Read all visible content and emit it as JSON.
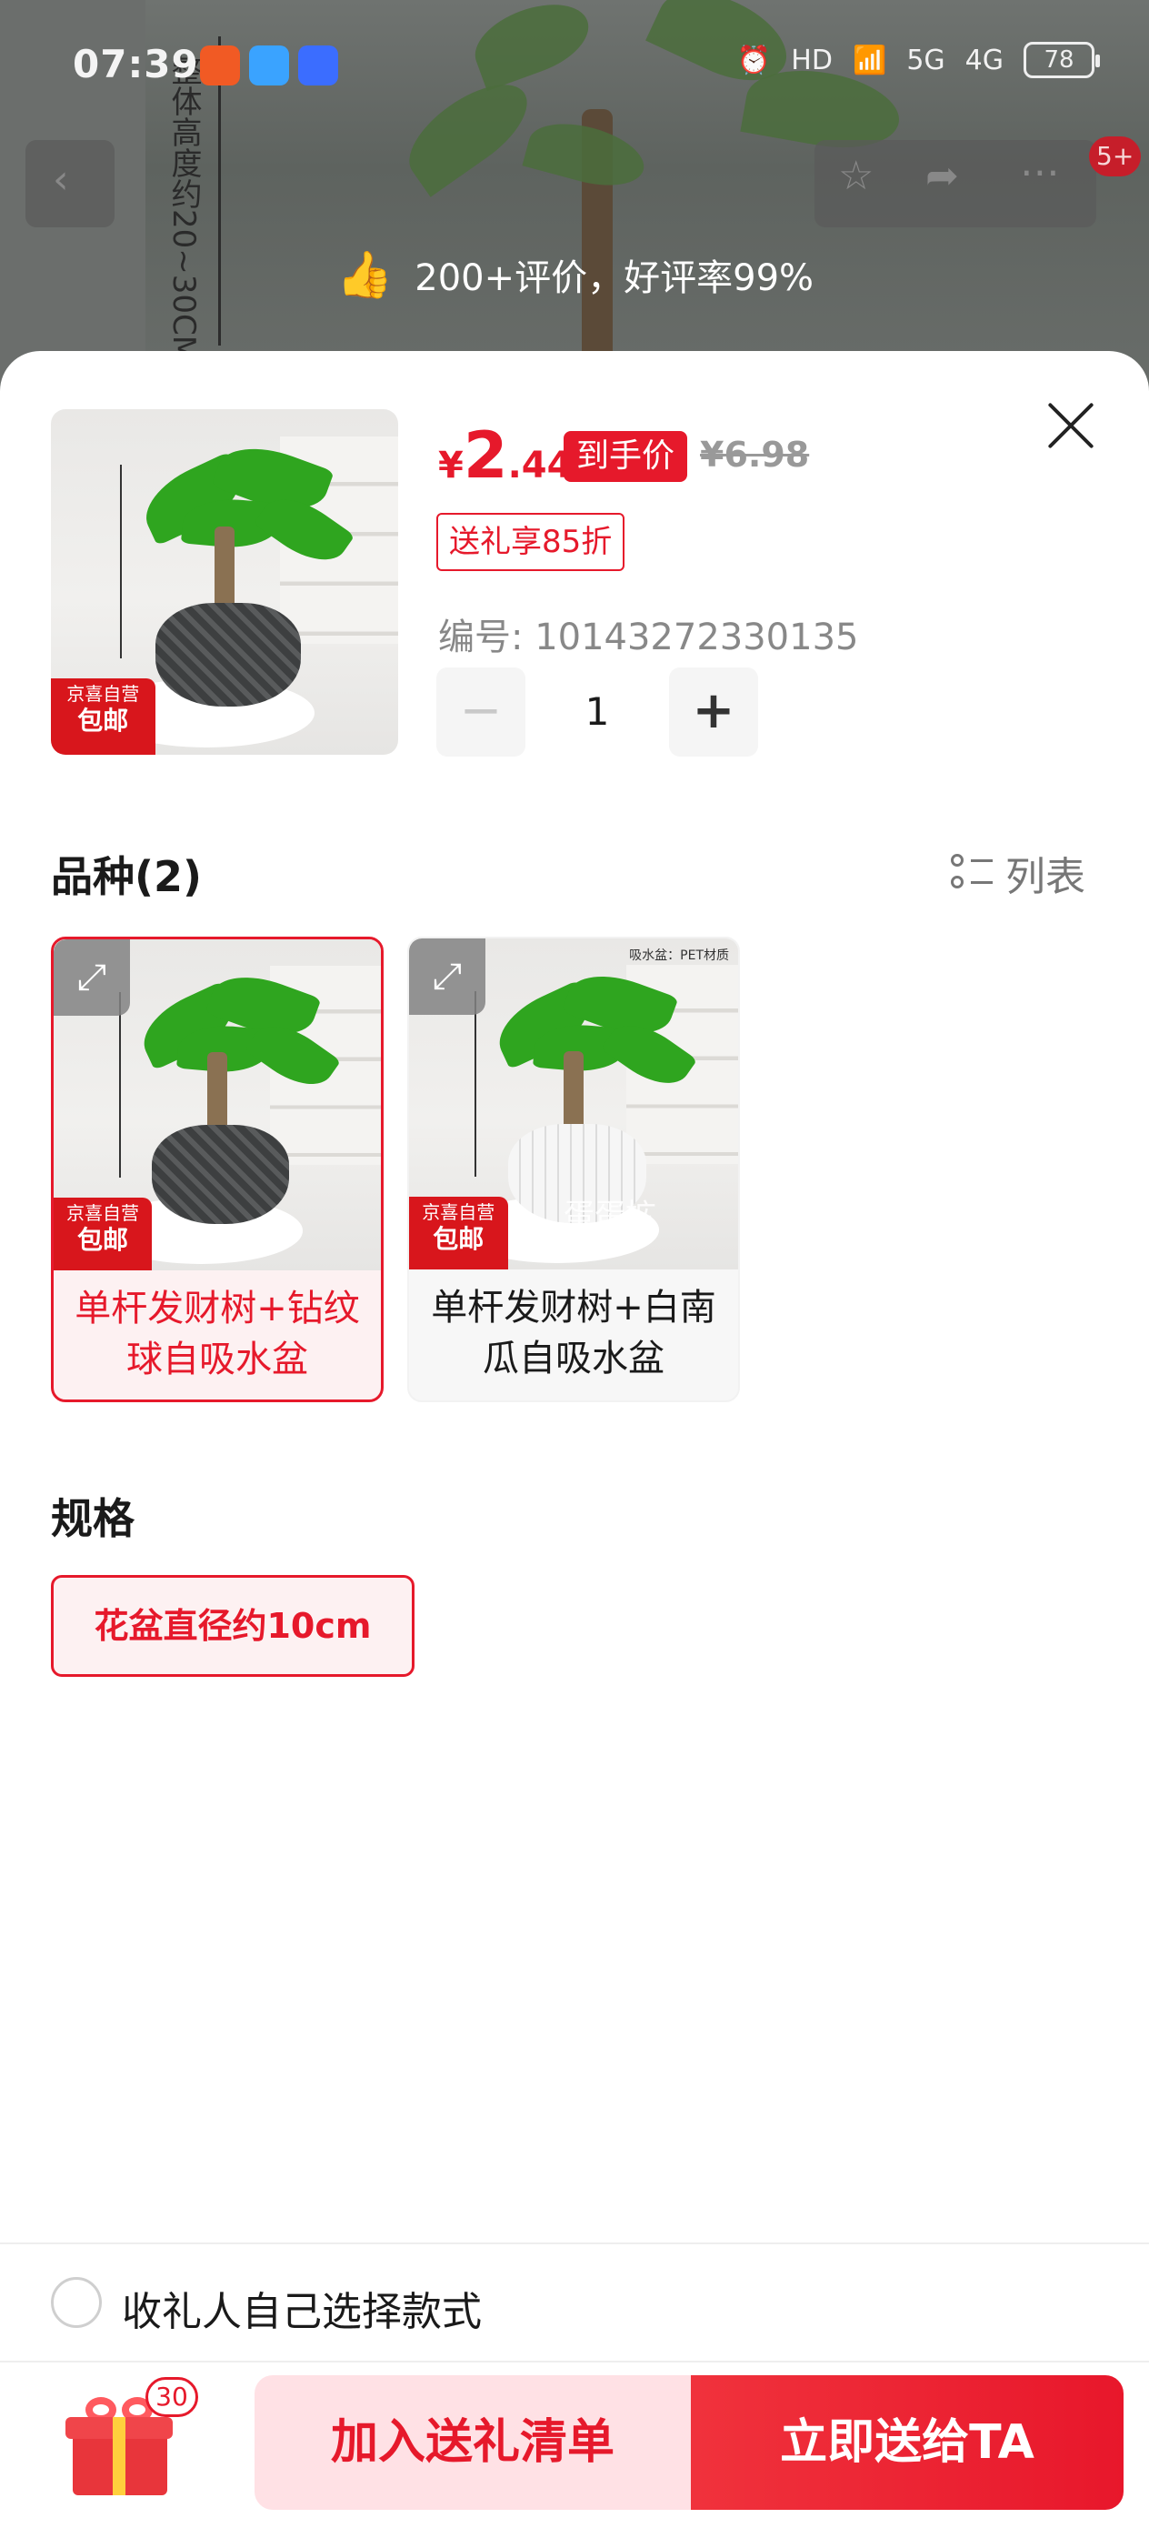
{
  "status_bar": {
    "time": "07:39",
    "network_hd": "HD",
    "network_5g": "5G",
    "network_4g": "4G",
    "battery": "78"
  },
  "background_page": {
    "badge": "5+",
    "image_text": "整体高度约20~30CM",
    "review_summary": "200+评价，好评率99%"
  },
  "product": {
    "price_currency": "¥",
    "price_integer": "2",
    "price_decimal": ".44",
    "price_tag": "到手价",
    "original_price": "¥6.98",
    "gift_discount": "送礼享85折",
    "sku": "编号: 10143272330135",
    "quantity": "1",
    "image_tag_line1": "京喜自营",
    "image_tag_line2": "包邮"
  },
  "variety": {
    "title": "品种(2)",
    "list_toggle": "列表",
    "options": [
      {
        "label": "单杆发财树+钻纹球自吸水盆",
        "selected": true,
        "tag_line1": "京喜自营",
        "tag_line2": "包邮"
      },
      {
        "label": "单杆发财树+白南瓜自吸水盆",
        "selected": false,
        "tag_line1": "京喜自营",
        "tag_line2": "包邮",
        "watermark": "蛋蛋拡",
        "corner_note": "吸水盆：PET材质"
      }
    ]
  },
  "spec": {
    "title": "规格",
    "options": [
      {
        "label": "花盆直径约10cm",
        "selected": true
      }
    ]
  },
  "recipient_choice": {
    "label": "收礼人自己选择款式",
    "checked": false
  },
  "footer": {
    "gift_count": "30",
    "add_to_gift_list": "加入送礼清单",
    "send_now": "立即送给TA"
  },
  "colors": {
    "accent": "#e6192b",
    "accent_light": "#ffe1e5"
  }
}
